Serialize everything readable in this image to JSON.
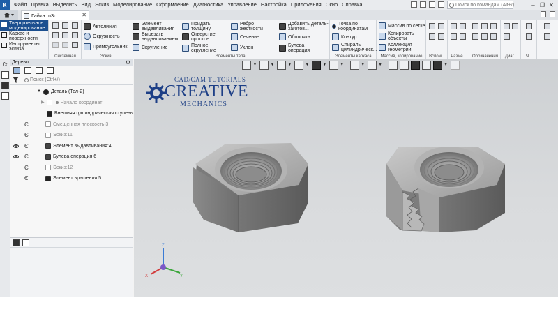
{
  "app": {
    "logo": "К",
    "menu": [
      "Файл",
      "Правка",
      "Выделить",
      "Вид",
      "Эскиз",
      "Моделирование",
      "Оформление",
      "Диагностика",
      "Управление",
      "Настройка",
      "Приложения",
      "Окно",
      "Справка"
    ],
    "command_search_placeholder": "Поиск по командам (Alt+/)",
    "window_controls": [
      "–",
      "❐",
      "✕"
    ]
  },
  "tabs": {
    "document": "Гайка.m3d",
    "close": "✕"
  },
  "ribbon": {
    "modes": [
      {
        "label": "Твердотельное моделирование",
        "icon": "solid-icon",
        "active": true
      },
      {
        "label": "Каркас и поверхности",
        "icon": "surface-icon",
        "active": false
      },
      {
        "label": "Инструменты эскиза",
        "icon": "sketch-tools-icon",
        "active": false
      }
    ],
    "groups": {
      "system": {
        "title": "Системная"
      },
      "sketch": {
        "title": "Эскиз",
        "buttons": [
          "Автолиния",
          "Окружность",
          "Прямоугольник"
        ]
      },
      "body": {
        "title": "Элементы тела",
        "buttons": [
          "Элемент выдавливания",
          "Вырезать выдавливанием",
          "Скругление",
          "Придать толщину",
          "Отверстие простое",
          "Полное скругление",
          "Ребро жесткости",
          "Сечение",
          "Уклон",
          "Добавить деталь-заготов...",
          "Оболочка",
          "Булева операция"
        ]
      },
      "wire": {
        "title": "Элементы каркаса",
        "buttons": [
          "Точка по координатам",
          "Контур",
          "Спираль цилиндрическ..."
        ]
      },
      "array": {
        "title": "Массив, копирование",
        "buttons": [
          "Массив по сетке",
          "Копировать объекты",
          "Коллекция геометрии"
        ]
      },
      "aux": {
        "title": "Вспом..."
      },
      "dims": {
        "title": "Разме..."
      },
      "notes": {
        "title": "Обозначения"
      },
      "diag": {
        "title": "Диаг..."
      },
      "other": {
        "title": "Ч..."
      }
    }
  },
  "tree": {
    "title": "Дерево",
    "search_placeholder": "Поиск (Ctrl+/)",
    "items": [
      {
        "label": "Деталь (Тел-2)",
        "icon": "part-icon",
        "eye": false,
        "epsilon": false
      },
      {
        "label": "Начало координат",
        "icon": "origin-icon",
        "eye": false,
        "epsilon": false
      },
      {
        "label": "Внешняя цилиндрическая ступень",
        "icon": "step-icon",
        "eye": false,
        "epsilon": false
      },
      {
        "label": "Смещенная плоскость:3",
        "icon": "plane-icon",
        "eye": false,
        "epsilon": true
      },
      {
        "label": "Эскиз:11",
        "icon": "sketch-icon",
        "eye": false,
        "epsilon": true
      },
      {
        "label": "Элемент выдавливания:4",
        "icon": "extrude-icon",
        "eye": true,
        "epsilon": true
      },
      {
        "label": "Булева операция:6",
        "icon": "boolean-icon",
        "eye": true,
        "epsilon": true
      },
      {
        "label": "Эскиз:12",
        "icon": "sketch-icon",
        "eye": false,
        "epsilon": true
      },
      {
        "label": "Элемент вращения:5",
        "icon": "revolve-icon",
        "eye": false,
        "epsilon": true
      }
    ]
  },
  "watermark": {
    "line1": "CAD/CAM TUTORIALS",
    "line2": "CREATIVE",
    "line3": "MECHANICS"
  },
  "axes": {
    "x": "X",
    "y": "Y",
    "z": "Z"
  }
}
